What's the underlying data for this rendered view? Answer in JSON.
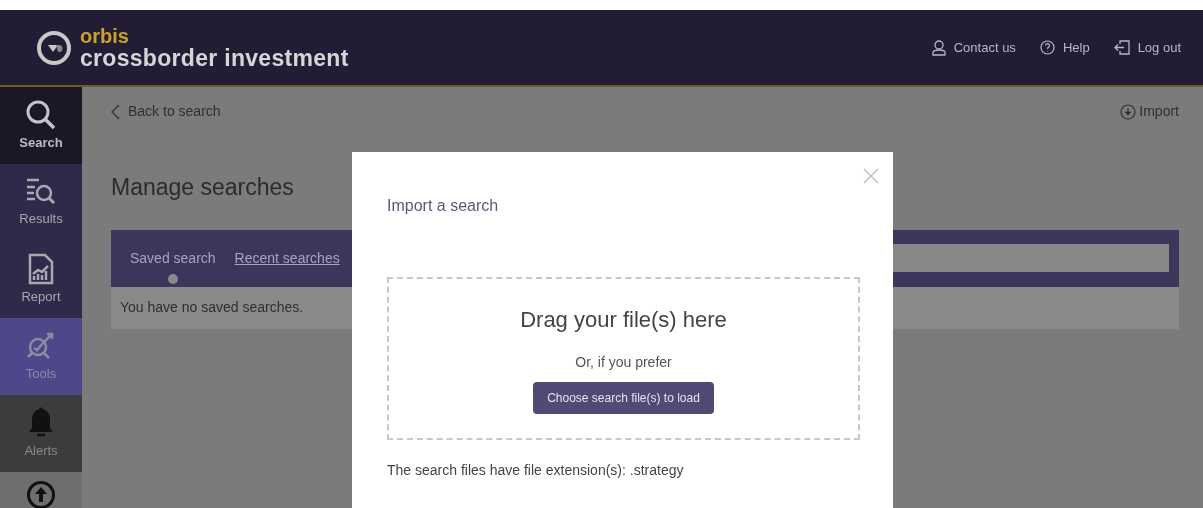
{
  "header": {
    "brand": "orbis",
    "product": "crossborder investment",
    "links": [
      {
        "label": "Contact us"
      },
      {
        "label": "Help"
      },
      {
        "label": "Log out"
      }
    ]
  },
  "sidebar": {
    "items": [
      {
        "label": "Search",
        "selected": true,
        "highlighted": false
      },
      {
        "label": "Results",
        "selected": false,
        "highlighted": false
      },
      {
        "label": "Report",
        "selected": false,
        "highlighted": false
      },
      {
        "label": "Tools",
        "selected": false,
        "highlighted": true
      },
      {
        "label": "Alerts",
        "selected": false,
        "highlighted": false
      },
      {
        "selected": false,
        "highlighted": false
      }
    ]
  },
  "page": {
    "back_link": "Back to search",
    "import_link": "Import",
    "title": "Manage searches",
    "tabs": [
      {
        "label": "Saved search",
        "selected": true
      },
      {
        "label": "Recent searches",
        "selected": false
      }
    ],
    "message": "You have no saved searches."
  },
  "modal": {
    "title": "Import a search",
    "drop_text": "Drag your file(s) here",
    "alt_text": "Or, if you prefer",
    "button": "Choose search file(s) to load",
    "note": "The search files have file extension(s): .strategy"
  }
}
